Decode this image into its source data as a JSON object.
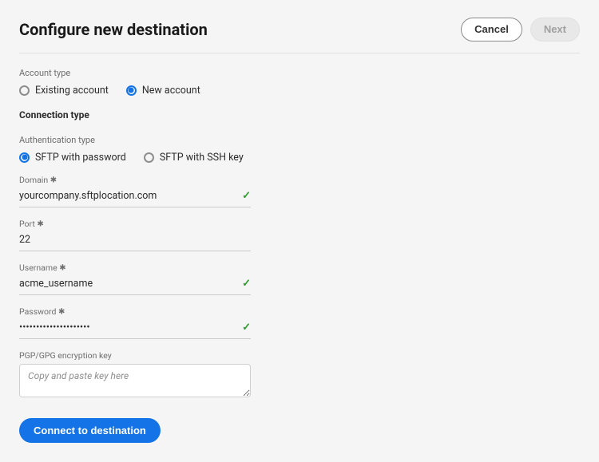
{
  "header": {
    "title": "Configure new destination",
    "cancel_label": "Cancel",
    "next_label": "Next"
  },
  "account_type": {
    "label": "Account type",
    "options": {
      "existing": "Existing account",
      "new": "New account"
    },
    "selected": "new"
  },
  "connection_type": {
    "label": "Connection type"
  },
  "authentication_type": {
    "label": "Authentication type",
    "options": {
      "password": "SFTP with password",
      "ssh": "SFTP with SSH key"
    },
    "selected": "password"
  },
  "fields": {
    "domain": {
      "label": "Domain",
      "value": "yourcompany.sftplocation.com",
      "valid": true,
      "required": true
    },
    "port": {
      "label": "Port",
      "value": "22",
      "valid": false,
      "required": true
    },
    "username": {
      "label": "Username",
      "value": "acme_username",
      "valid": true,
      "required": true
    },
    "password": {
      "label": "Password",
      "value": "•••••••••••••••••••••",
      "valid": true,
      "required": true
    },
    "pgp": {
      "label": "PGP/GPG encryption key",
      "placeholder": "Copy and paste key here",
      "required": false
    }
  },
  "connect_label": "Connect to destination",
  "required_glyph": "✱"
}
